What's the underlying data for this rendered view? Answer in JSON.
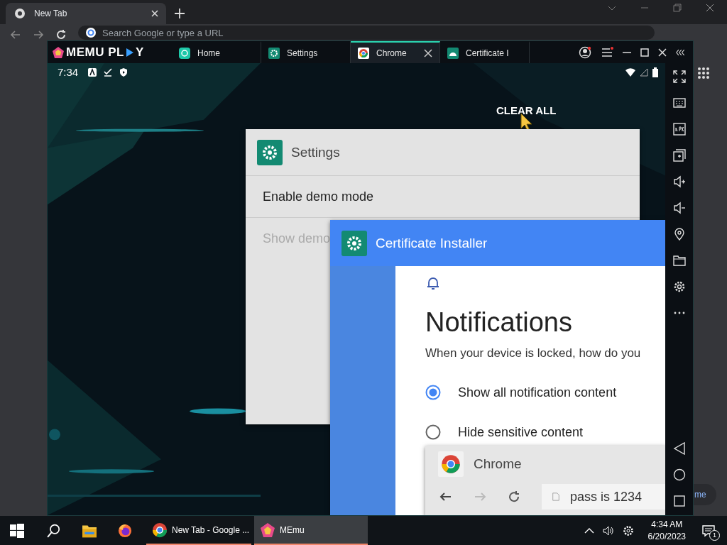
{
  "browser": {
    "tab": "New Tab",
    "omnibox": {
      "placeholder": "Search Google or type a URL"
    },
    "page_button": "me"
  },
  "emulator": {
    "logo": [
      "MEMU PL",
      "Y"
    ],
    "tabs": [
      {
        "kind": "home",
        "label": "Home",
        "selected": false,
        "closable": false
      },
      {
        "kind": "settings",
        "label": "Settings",
        "selected": false,
        "closable": false
      },
      {
        "kind": "chrome",
        "label": "Chrome",
        "selected": true,
        "closable": true
      },
      {
        "kind": "android",
        "label": "Certificate I",
        "selected": false,
        "closable": false
      }
    ],
    "status": {
      "time": "7:34"
    },
    "clear_all": "CLEAR ALL",
    "settings_card": {
      "title": "Settings",
      "rows": [
        {
          "label": "Enable demo mode",
          "disabled": false
        },
        {
          "label": "Show demo",
          "disabled": true
        }
      ]
    },
    "installer_card": {
      "title": "Certificate Installer",
      "heading": "Notifications",
      "subtitle": "When your device is locked, how do you",
      "options": [
        {
          "label": "Show all notification content",
          "selected": true
        },
        {
          "label": "Hide sensitive content",
          "selected": false
        }
      ]
    },
    "chrome_card": {
      "title": "Chrome",
      "url": "pass is 1234"
    }
  },
  "taskbar": {
    "apps": [
      {
        "kind": "chrome",
        "label": "New Tab - Google ...",
        "selected": false
      },
      {
        "kind": "memu",
        "label": "MEmu",
        "selected": true
      }
    ],
    "time": "4:34 AM",
    "date": "6/20/2023",
    "notifications": "1"
  }
}
